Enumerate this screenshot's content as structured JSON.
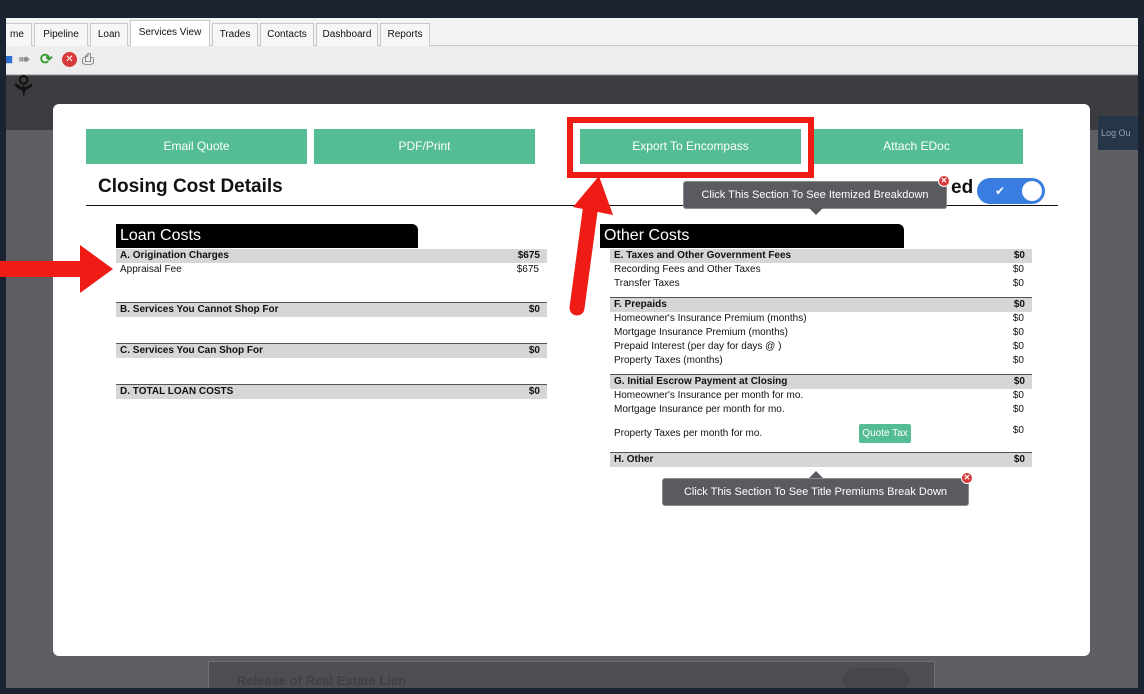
{
  "tabs": [
    "me",
    "Pipeline",
    "Loan",
    "Services View",
    "Trades",
    "Contacts",
    "Dashboard",
    "Reports"
  ],
  "active_tab": "Services View",
  "toolbar_icons": [
    "back-icon",
    "forward-icon",
    "refresh-icon",
    "cancel-icon",
    "print-icon"
  ],
  "header": {
    "logout_label": "Log Ou"
  },
  "background_row": {
    "label": "Release of Real Estate Lien"
  },
  "modal": {
    "buttons": {
      "email_quote": "Email Quote",
      "pdf_print": "PDF/Print",
      "export_encompass": "Export To Encompass",
      "attach_edoc": "Attach EDoc"
    },
    "title": "Closing Cost Details",
    "itemized_suffix": "ed",
    "itemized_toggle_on": true,
    "tooltips": {
      "itemized": "Click This Section To See Itemized Breakdown",
      "title_premiums": "Click This Section To See Title Premiums Break Down"
    },
    "loan_costs": {
      "header": "Loan Costs",
      "origination": {
        "label": "A. Origination Charges",
        "amount": "$675",
        "items": [
          {
            "label": "Appraisal Fee",
            "amount": "$675"
          }
        ]
      },
      "cannot_shop": {
        "label": "B. Services You Cannot Shop For",
        "amount": "$0"
      },
      "can_shop": {
        "label": "C. Services You Can Shop For",
        "amount": "$0"
      },
      "total": {
        "label": "D. TOTAL LOAN COSTS",
        "amount": "$0"
      }
    },
    "other_costs": {
      "header": "Other Costs",
      "taxes": {
        "label": "E. Taxes and Other Government Fees",
        "amount": "$0",
        "items": [
          {
            "label": "Recording Fees and Other Taxes",
            "amount": "$0"
          },
          {
            "label": "Transfer Taxes",
            "amount": "$0"
          }
        ]
      },
      "prepaids": {
        "label": "F. Prepaids",
        "amount": "$0",
        "items": [
          {
            "label": "Homeowner's Insurance Premium (months)",
            "amount": "$0"
          },
          {
            "label": "Mortgage Insurance Premium (months)",
            "amount": "$0"
          },
          {
            "label": "Prepaid Interest (per day for days @ )",
            "amount": "$0"
          },
          {
            "label": "Property Taxes (months)",
            "amount": "$0"
          }
        ]
      },
      "escrow": {
        "label": "G. Initial Escrow Payment at Closing",
        "amount": "$0",
        "items": [
          {
            "label": "Homeowner's Insurance per month for mo.",
            "amount": "$0"
          },
          {
            "label": "Mortgage Insurance per month for mo.",
            "amount": "$0"
          },
          {
            "label": "Property Taxes per month for mo.",
            "amount": "$0"
          }
        ],
        "quote_tax_label": "Quote Tax"
      },
      "other": {
        "label": "H. Other",
        "amount": "$0"
      }
    }
  },
  "colors": {
    "accent_green": "#55bd94",
    "annotation_red": "#ee1c14",
    "toggle_blue": "#3a7de0",
    "header_black": "#000000"
  }
}
